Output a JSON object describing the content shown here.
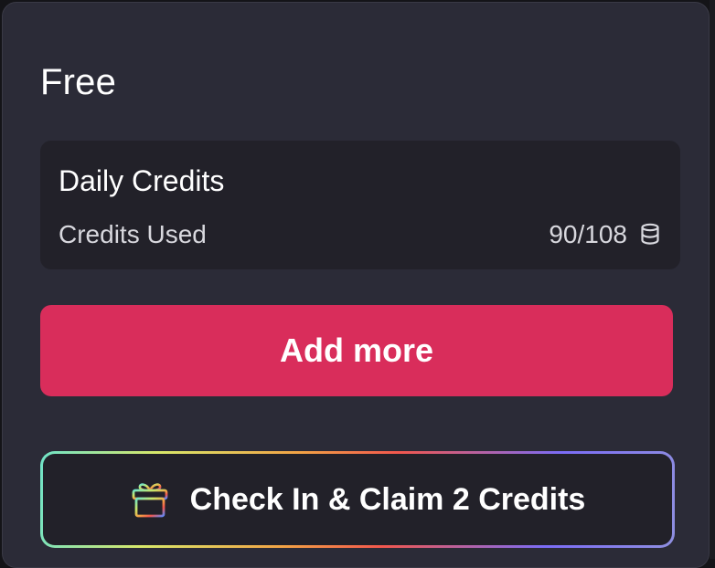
{
  "plan": {
    "title": "Free"
  },
  "daily_credits": {
    "heading": "Daily Credits",
    "used_label": "Credits Used",
    "used_value": "90/108",
    "used": 90,
    "total": 108,
    "icon": "coin-stack-icon"
  },
  "actions": {
    "add_more_label": "Add more",
    "checkin_label": "Check In & Claim 2 Credits",
    "checkin_icon": "gift-icon"
  },
  "colors": {
    "panel": "#2b2b37",
    "card": "#222129",
    "accent": "#d92d5b",
    "text": "#ffffff"
  }
}
